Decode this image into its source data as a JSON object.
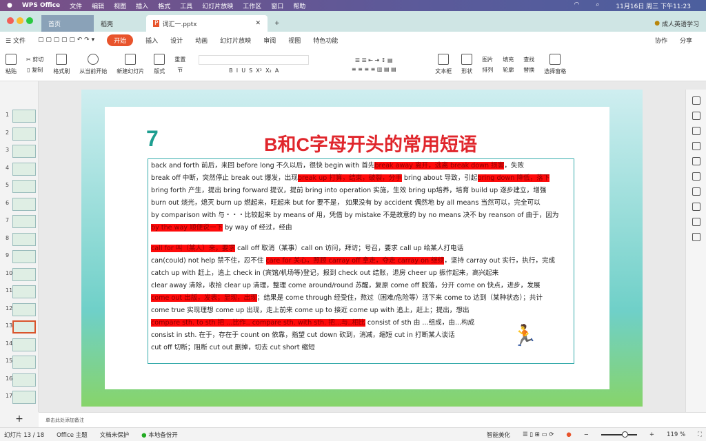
{
  "menubar": {
    "app": "WPS Office",
    "items": [
      "文件",
      "编辑",
      "视图",
      "插入",
      "格式",
      "工具",
      "幻灯片放映",
      "工作区",
      "窗口",
      "帮助"
    ],
    "clock": "11月16日 周三 下午11:23"
  },
  "tabs": [
    {
      "label": "首页"
    },
    {
      "label": "稻壳"
    },
    {
      "label": "词汇一.pptx"
    }
  ],
  "account": "成人英语学习",
  "ribbon_tabs": [
    "文件",
    "开始",
    "插入",
    "设计",
    "动画",
    "幻灯片放映",
    "审阅",
    "视图",
    "特色功能"
  ],
  "ribbon_right": [
    "协作",
    "分享"
  ],
  "tools": [
    "粘贴",
    "剪切",
    "复制",
    "格式刷",
    "从当前开始",
    "新建幻灯片",
    "版式",
    "重置",
    "节",
    "文本框",
    "形状",
    "图片",
    "排列",
    "填充",
    "轮廓",
    "查找",
    "替换",
    "选择窗格"
  ],
  "slide": {
    "number": "7",
    "title": "B和C字母开头的常用短语",
    "lines": [
      [
        {
          "t": "back and forth 前后，来回  before long 不久以后，很快 begin with 首先"
        },
        {
          "t": "break away 离开，逃离 break down 损害",
          "hl": true
        },
        {
          "t": "，失败"
        }
      ],
      [
        {
          "t": "break off 中断，突然停止 break out 爆发，出现"
        },
        {
          "t": "break up 打算，结束，破裂，分手",
          "hl": true
        },
        {
          "t": " bring about 导致，引起"
        },
        {
          "t": "bring down 降低，落下",
          "hl": true
        }
      ],
      [
        {
          "t": "bring forth 产生，提出 bring forward 提议，提前 bring into operation 实施，生效 bring up培养，培育 build up 逐步建立，增强"
        }
      ],
      [
        {
          "t": "burn out 烧光，熄灭 burn up 燃起来，旺起来 but for 要不是， 如果没有 by accident 偶然地  by all means 当然可以，完全可以"
        }
      ],
      [
        {
          "t": "by comparison with 与・・・比较起来 by means of 用，凭借 by mistake 不是故意的 by no means 决不 by reanson of 由于，因为"
        }
      ],
      [
        {
          "t": "by the way 顺便说一下",
          "hl": true
        },
        {
          "t": "  by way of 经过，经由"
        }
      ],
      [
        {
          "t": "call  for 叫（某人）来，要求",
          "hl": true
        },
        {
          "t": " call off 取消（某事）call on 访问，拜访；号召，要求 call up 给某人打电话"
        }
      ],
      [
        {
          "t": "can(could) not help 禁不住，忍不住 "
        },
        {
          "t": "care for 关心，照顾 carray off 拿走，夺走 carray on 继续",
          "hl": true
        },
        {
          "t": "，坚持 carray out 实行，执行，完成"
        }
      ],
      [
        {
          "t": "catch up with 赶上，追上 check in (宾馆/机场等)登记，报到 check out 结账，退房 cheer up 振作起来，高兴起来"
        }
      ],
      [
        {
          "t": "clear away 清除，收拾 clear up 清理，整理 come around/round 苏醒，复原 come off 脱落，分开 come on 快点，进步，发展"
        }
      ],
      [
        {
          "t": "come out 出版，发表；显现，出现",
          "hl": true
        },
        {
          "t": "；结果是 come through 经受住，熬过（困难/危险等）活下来 come to 达到（某种状态）；共计"
        }
      ],
      [
        {
          "t": "come true 实现理想 come up 出现，走上前来 come up to 接近 come up with 追上，赶上；提出，想出"
        }
      ],
      [
        {
          "t": "compare sth. to sth 把 ...比作.. compare sth. with sth. 把...与..相比",
          "hl": true
        },
        {
          "t": " consist of sth 由 ...组成，由...构成"
        }
      ],
      [
        {
          "t": "consist in sth. 在于，存在于 count on 依靠，指望 cut down 砍到，消减，缩短 cut in 打断某人谈话"
        }
      ],
      [
        {
          "t": "cut off 切断；阻断  cut out 删掉，切去 cut short 缩短"
        }
      ]
    ]
  },
  "notes_placeholder": "单击此处添加备注",
  "status": {
    "slide": "幻灯片 13 / 18",
    "theme": "Office 主题",
    "protect": "文档未保护",
    "backup": "本地备份开",
    "beautify": "智能美化",
    "zoom": "119 %",
    "zoom_level": 119
  },
  "colors": {
    "accent": "#e8542c",
    "highlight": "#ff0a0a",
    "title": "#e0262c",
    "number": "#1d9e90"
  }
}
